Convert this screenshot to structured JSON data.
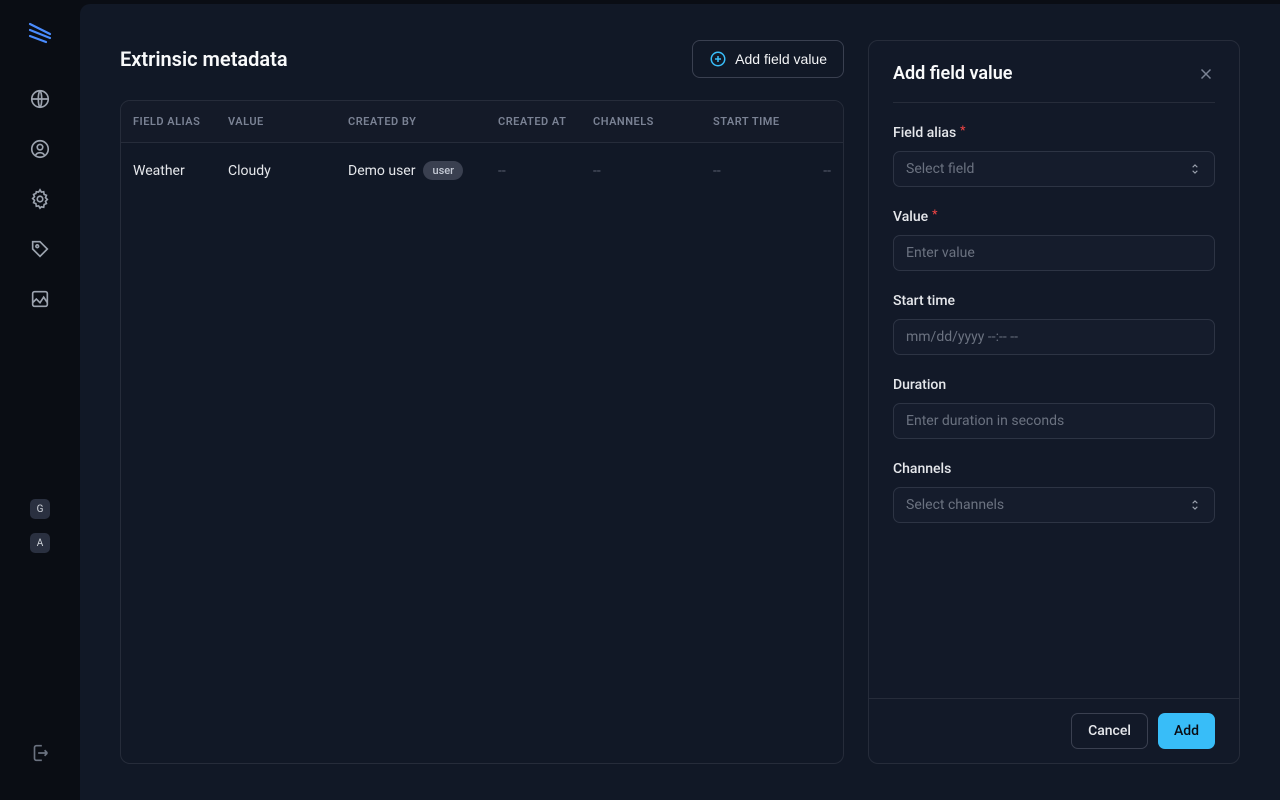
{
  "sidebar": {
    "badges": [
      "G",
      "A"
    ]
  },
  "header": {
    "title": "Extrinsic metadata",
    "add_button": "Add field value"
  },
  "table": {
    "columns": {
      "field_alias": "FIELD ALIAS",
      "value": "VALUE",
      "created_by": "CREATED BY",
      "created_at": "CREATED AT",
      "channels": "CHANNELS",
      "start_time": "START TIME"
    },
    "rows": [
      {
        "field_alias": "Weather",
        "value": "Cloudy",
        "created_by_name": "Demo user",
        "created_by_role": "user",
        "created_at": "--",
        "channels": "--",
        "start_time": "--",
        "end": "--"
      }
    ]
  },
  "panel": {
    "title": "Add field value",
    "fields": {
      "field_alias": {
        "label": "Field alias",
        "placeholder": "Select field"
      },
      "value": {
        "label": "Value",
        "placeholder": "Enter value"
      },
      "start_time": {
        "label": "Start time",
        "placeholder": "mm/dd/yyyy --:-- --"
      },
      "duration": {
        "label": "Duration",
        "placeholder": "Enter duration in seconds"
      },
      "channels": {
        "label": "Channels",
        "placeholder": "Select channels"
      }
    },
    "footer": {
      "cancel": "Cancel",
      "add": "Add"
    }
  }
}
